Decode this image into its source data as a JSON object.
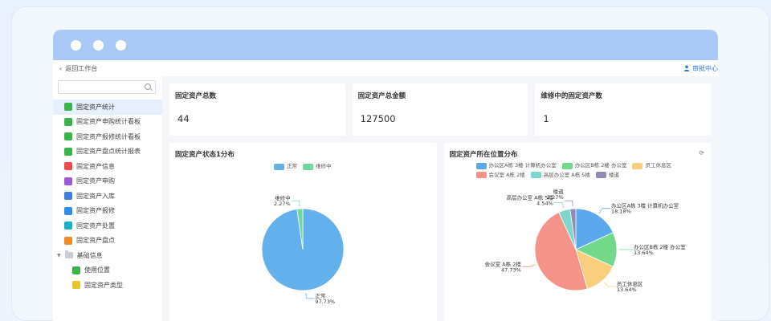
{
  "topnav": {
    "back_label": "返回工作台",
    "approve_label": "审批中心"
  },
  "sidebar": {
    "items": [
      {
        "label": "固定资产统计",
        "color": "#3bb54a",
        "active": true
      },
      {
        "label": "固定资产申购统计看板",
        "color": "#3bb54a"
      },
      {
        "label": "固定资产报修统计看板",
        "color": "#3bb54a"
      },
      {
        "label": "固定资产盘点统计报表",
        "color": "#3bb54a"
      },
      {
        "label": "固定资产信息",
        "color": "#ef4b4b"
      },
      {
        "label": "固定资产申购",
        "color": "#9b59d6"
      },
      {
        "label": "固定资产入库",
        "color": "#3f7fe0"
      },
      {
        "label": "固定资产报修",
        "color": "#2f8fe8"
      },
      {
        "label": "固定资产处置",
        "color": "#19b2c7"
      },
      {
        "label": "固定资产盘点",
        "color": "#f08a24"
      }
    ],
    "folder_label": "基础信息",
    "sub_items": [
      {
        "label": "使用位置",
        "color": "#3bb54a"
      },
      {
        "label": "固定资产类型",
        "color": "#e8c62a"
      }
    ]
  },
  "stats": [
    {
      "title": "固定资产总数",
      "value": "44"
    },
    {
      "title": "固定资产总金额",
      "value": "127500"
    },
    {
      "title": "维修中的固定资产数",
      "value": "1"
    }
  ],
  "charts": {
    "status_title": "固定资产状态1分布",
    "location_title": "固定资产所在位置分布"
  },
  "chart_data": [
    {
      "type": "pie",
      "title": "固定资产状态1分布",
      "legend": "top-center",
      "slices": [
        {
          "name": "正常",
          "value": 97.73,
          "label": "97.73%",
          "color": "#62b0ec"
        },
        {
          "name": "维修中",
          "value": 2.27,
          "label": "2.27%",
          "color": "#6fd99c"
        }
      ]
    },
    {
      "type": "pie",
      "title": "固定资产所在位置分布",
      "legend": "top-center",
      "slices": [
        {
          "name": "办公区A栋 3楼 计算机办公室",
          "value": 18.18,
          "label": "18.18%",
          "color": "#5ca8ec"
        },
        {
          "name": "办公区B栋 2楼 办公室",
          "value": 13.64,
          "label": "13.64%",
          "color": "#72d98a"
        },
        {
          "name": "员工休息区",
          "value": 13.64,
          "label": "13.64%",
          "color": "#f9cf7e"
        },
        {
          "name": "会议室 A栋 2楼",
          "value": 47.73,
          "label": "47.73%",
          "color": "#f59388"
        },
        {
          "name": "高层办公室 A栋 5楼",
          "value": 4.54,
          "label": "4.54%",
          "color": "#7dd7cd"
        },
        {
          "name": "楼道",
          "value": 2.27,
          "label": "2.27%",
          "color": "#8f8cb3"
        }
      ]
    }
  ]
}
